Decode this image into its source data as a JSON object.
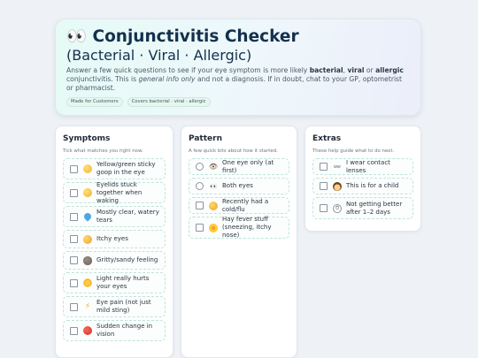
{
  "hero": {
    "title_emoji": "👀",
    "title": "Conjunctivitis Checker",
    "subtitle": "(Bacterial · Viral · Allergic)",
    "desc_1": "Answer a few quick questions to see if your eye symptom is more likely ",
    "desc_bacterial": "bacterial",
    "desc_sep1": ", ",
    "desc_viral": "viral",
    "desc_or": " or ",
    "desc_allergic": "allergic",
    "desc_2": " conjunctivitis. This is ",
    "desc_em": "general info only",
    "desc_3": " and not a diagnosis. If in doubt, chat to your GP, optometrist or pharmacist.",
    "tags": [
      "Made for Customers",
      "Covers bacterial · viral · allergic"
    ]
  },
  "symptoms": {
    "title": "Symptoms",
    "subtitle": "Tick what matches you right now.",
    "items": [
      {
        "icon": "yellow-circle-icon",
        "label": "Yellow/green sticky goop in the eye"
      },
      {
        "icon": "sleepy-face-icon",
        "label": "Eyelids stuck together when waking"
      },
      {
        "icon": "water-drop-icon",
        "label": "Mostly clear, watery tears"
      },
      {
        "icon": "itchy-face-icon",
        "label": "Itchy eyes"
      },
      {
        "icon": "rock-icon",
        "label": "Gritty/sandy feeling"
      },
      {
        "icon": "sun-icon",
        "label": "Light really hurts your eyes"
      },
      {
        "icon": "lightning-icon",
        "label": "Eye pain (not just mild sting)"
      },
      {
        "icon": "red-circle-icon",
        "label": "Sudden change in vision"
      }
    ]
  },
  "pattern": {
    "title": "Pattern",
    "subtitle": "A few quick bits about how it started.",
    "items": [
      {
        "type": "radio",
        "icon": "eye-icon",
        "glyph": "👁",
        "label": "One eye only (at first)"
      },
      {
        "type": "radio",
        "icon": "eyes-icon",
        "glyph": "👀",
        "label": "Both eyes"
      },
      {
        "type": "checkbox",
        "icon": "cold-face-icon",
        "glyph": "",
        "label": "Recently had a cold/flu"
      },
      {
        "type": "checkbox",
        "icon": "flower-icon",
        "glyph": "",
        "label": "Hay fever stuff (sneezing, itchy nose)"
      }
    ]
  },
  "extras": {
    "title": "Extras",
    "subtitle": "These help guide what to do next.",
    "items": [
      {
        "icon": "glasses-icon",
        "glyph": "👓",
        "label": "I wear contact lenses"
      },
      {
        "icon": "child-icon",
        "glyph": "",
        "label": "This is for a child"
      },
      {
        "icon": "clock-icon",
        "glyph": "⏱",
        "label": "Not getting better after 1–2 days"
      }
    ]
  }
}
